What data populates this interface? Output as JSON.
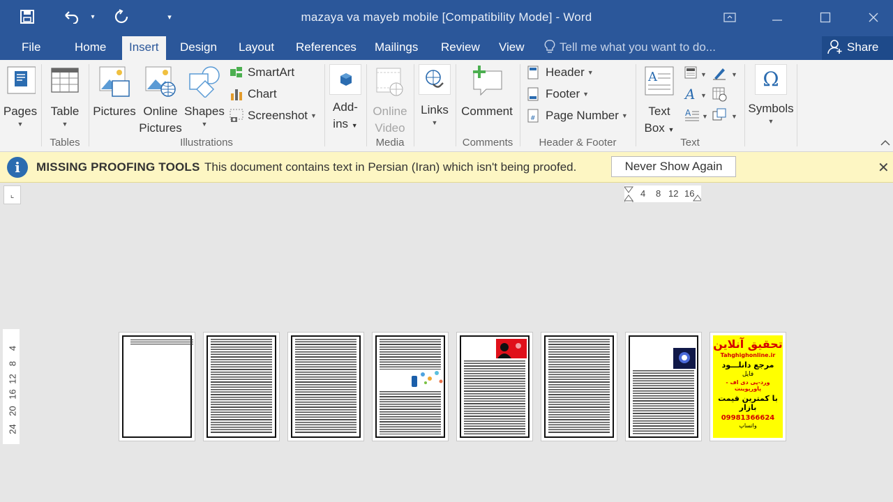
{
  "window": {
    "title": "mazaya va mayeb mobile [Compatibility Mode] - Word"
  },
  "menu": {
    "tabs": [
      {
        "label": "File"
      },
      {
        "label": "Home"
      },
      {
        "label": "Insert"
      },
      {
        "label": "Design"
      },
      {
        "label": "Layout"
      },
      {
        "label": "References"
      },
      {
        "label": "Mailings"
      },
      {
        "label": "Review"
      },
      {
        "label": "View"
      }
    ],
    "active_tab": "Insert",
    "tell_me": "Tell me what you want to do...",
    "share": "Share"
  },
  "ribbon": {
    "pages": "Pages",
    "table": "Table",
    "pictures": "Pictures",
    "online_pictures_1": "Online",
    "online_pictures_2": "Pictures",
    "shapes": "Shapes",
    "smartart": "SmartArt",
    "chart": "Chart",
    "screenshot": "Screenshot",
    "addins_1": "Add-",
    "addins_2": "ins",
    "online_video_1": "Online",
    "online_video_2": "Video",
    "links": "Links",
    "comment": "Comment",
    "header": "Header",
    "footer": "Footer",
    "page_number": "Page Number",
    "text_box_1": "Text",
    "text_box_2": "Box",
    "symbols": "Symbols",
    "groups": {
      "tables": "Tables",
      "illustrations": "Illustrations",
      "media": "Media",
      "comments": "Comments",
      "header_footer": "Header & Footer",
      "text": "Text"
    }
  },
  "message_bar": {
    "title": "MISSING PROOFING TOOLS",
    "text": "This document contains text in Persian (Iran) which isn't being proofed.",
    "button": "Never Show Again"
  },
  "rulers": {
    "horizontal": [
      "4",
      "8",
      "12",
      "16"
    ],
    "vertical": [
      "4",
      "8",
      "12",
      "16",
      "20",
      "24"
    ]
  },
  "thumbnail_ad": {
    "line1": "تحقیق آنلاین",
    "line2": "Tahghighonline.ir",
    "line3": "مرجع دانلـــود",
    "line4": "فایل",
    "line5": "ورد-پی دی اف - پاورپوینت",
    "line6": "با کمترین قیمت بازار",
    "line7": "09981366624",
    "line8": "واتساپ"
  },
  "colors": {
    "word_blue": "#2b579a",
    "message_bar": "#fdf6c3",
    "ad_yellow": "#ffff00",
    "ad_red": "#d40000"
  }
}
